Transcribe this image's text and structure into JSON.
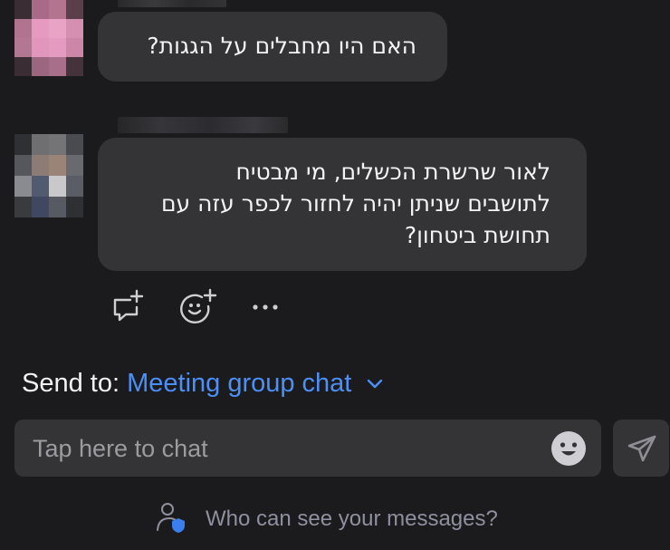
{
  "messages": [
    {
      "text": "האם היו מחבלים על הגגות?"
    },
    {
      "lines": [
        "לאור שרשרת הכשלים, מי מבטיח",
        "לתושבים שניתן יהיה לחזור לכפר עזה עם",
        "תחושת ביטחון?"
      ]
    }
  ],
  "reactions": {
    "icons": [
      "reply-add-icon",
      "emoji-add-icon",
      "more-options-icon"
    ]
  },
  "send_to": {
    "label": "Send to:",
    "target": "Meeting group chat"
  },
  "chat_input": {
    "placeholder": "Tap here to chat"
  },
  "privacy_link": {
    "text": "Who can see your messages?"
  },
  "colors": {
    "background": "#1b1b1d",
    "bubble": "#343437",
    "accent_blue": "#4b8ff7",
    "muted_text": "#8f8fa0"
  }
}
